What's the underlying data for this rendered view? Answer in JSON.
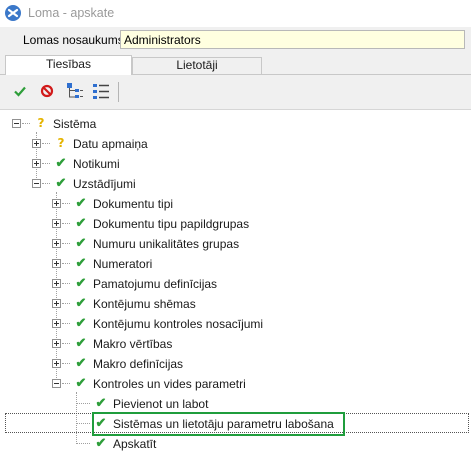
{
  "window": {
    "title": "Loma - apskate"
  },
  "form": {
    "name_label": "Lomas nosaukums:",
    "name_value": "Administrators"
  },
  "tabs": [
    {
      "label": "Tiesības",
      "active": true
    },
    {
      "label": "Lietotāji",
      "active": false
    }
  ],
  "toolbar": {
    "buttons": [
      {
        "icon": "checkmark-icon"
      },
      {
        "icon": "deny-icon"
      },
      {
        "icon": "tree-structure-icon"
      },
      {
        "icon": "list-icon"
      }
    ]
  },
  "colors": {
    "check": "#2e9e3a",
    "question": "#e5b400",
    "highlight_border": "#1f9d3c",
    "name_field_bg": "#ffffe0"
  },
  "tree": [
    {
      "label": "Sistēma",
      "level": 0,
      "state": "partial",
      "expander": "minus"
    },
    {
      "label": "Datu apmaiņa",
      "level": 1,
      "state": "partial",
      "expander": "plus"
    },
    {
      "label": "Notikumi",
      "level": 1,
      "state": "allowed",
      "expander": "plus"
    },
    {
      "label": "Uzstādījumi",
      "level": 1,
      "state": "allowed",
      "expander": "minus"
    },
    {
      "label": "Dokumentu tipi",
      "level": 2,
      "state": "allowed",
      "expander": "plus"
    },
    {
      "label": "Dokumentu tipu papildgrupas",
      "level": 2,
      "state": "allowed",
      "expander": "plus"
    },
    {
      "label": "Numuru unikalitātes grupas",
      "level": 2,
      "state": "allowed",
      "expander": "plus"
    },
    {
      "label": "Numeratori",
      "level": 2,
      "state": "allowed",
      "expander": "plus"
    },
    {
      "label": "Pamatojumu definīcijas",
      "level": 2,
      "state": "allowed",
      "expander": "plus"
    },
    {
      "label": "Kontējumu shēmas",
      "level": 2,
      "state": "allowed",
      "expander": "plus"
    },
    {
      "label": "Kontējumu kontroles nosacījumi",
      "level": 2,
      "state": "allowed",
      "expander": "plus"
    },
    {
      "label": "Makro vērtības",
      "level": 2,
      "state": "allowed",
      "expander": "plus"
    },
    {
      "label": "Makro definīcijas",
      "level": 2,
      "state": "allowed",
      "expander": "plus"
    },
    {
      "label": "Kontroles un vides parametri",
      "level": 2,
      "state": "allowed",
      "expander": "minus"
    },
    {
      "label": "Pievienot un labot",
      "level": 3,
      "state": "allowed",
      "expander": "none"
    },
    {
      "label": "Sistēmas un lietotāju parametru labošana",
      "level": 3,
      "state": "allowed",
      "expander": "none",
      "selected": true,
      "highlighted": true
    },
    {
      "label": "Apskatīt",
      "level": 3,
      "state": "allowed",
      "expander": "none"
    }
  ]
}
